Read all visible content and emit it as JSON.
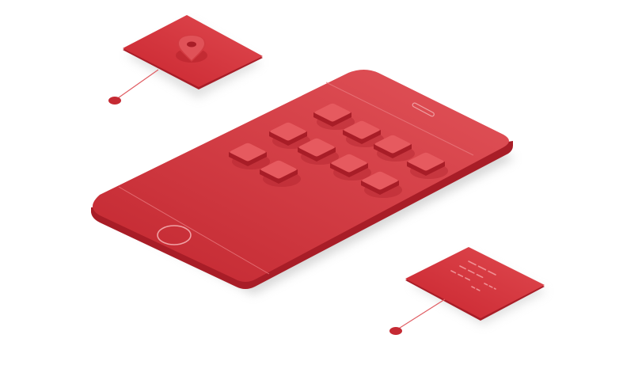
{
  "colors": {
    "background": "#ffffff",
    "phone_body_light": "#e04a4f",
    "phone_body_dark": "#c52a33",
    "phone_edge": "#a81d27",
    "app_tile": "#d8454b",
    "app_tile_top": "#e65a5f",
    "card_face": "#d9363f",
    "connector_line": "#e05c62",
    "connector_dot": "#c52a33",
    "shadow": "#bfbfbf"
  },
  "phone": {
    "app_icon_count": 10,
    "home_button_icon": "home-button-circle",
    "speaker_icon": "speaker-slot"
  },
  "location_card": {
    "icon": "location-pin-icon"
  },
  "text_card": {
    "icon": "text-lines-icon",
    "line_count": 3
  }
}
